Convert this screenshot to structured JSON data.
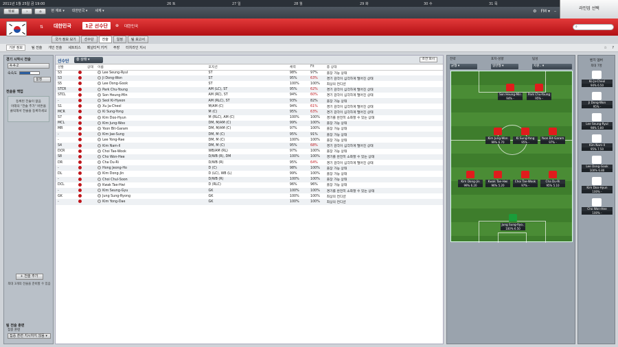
{
  "topbar": {
    "date": "2011년 1월 25일 금 19:00",
    "calendar": [
      "26 토",
      "27 일",
      "28 월",
      "29 화",
      "30 수",
      "31 목"
    ],
    "back": "뒤로",
    "nav": [
      "현 재로 ▾",
      "대한민국 ▾",
      "세계 ▾"
    ],
    "fm": "FM ▾",
    "continue": "라인업 선택"
  },
  "header": {
    "title": "대한민국",
    "squad": "1군 선수단",
    "subtitle": "대한민국",
    "search_placeholder": ""
  },
  "tabs": [
    "국가 정보 보기",
    "선수단",
    "전술",
    "일정",
    "팀 보고서"
  ],
  "subnav": [
    "기본 정보",
    "팀 전술",
    "개인 전술",
    "세트피스",
    "페널티킥 키커",
    "주장",
    "터치라인 지시"
  ],
  "left": {
    "title": "경기 시작시 전술",
    "formation": "4-4-2",
    "familiarity_label": "숙숙도",
    "familiarity": 0.55,
    "view": "설정",
    "backup_title": "전술용 백업",
    "note": "등록된 전술이 없음\n아래의 \"전술 추가\" 버튼을\n클릭해서 전술을 등록하세요",
    "add_button": "+ 전술 추가",
    "hint": "최대 3개의 전술을 준비할 수 있음",
    "match_title": "팀 전술 훈련",
    "training_label": "집중 훈련",
    "training_value": "집중 훈련 지시하지 않음 ▾"
  },
  "squad": {
    "label": "선수단",
    "view": "총 상태 ▾",
    "filter": "조건 표시",
    "columns": [
      "선발",
      "",
      "상태",
      "이름",
      "포지션",
      "체력",
      "Fit",
      "종 상태"
    ]
  },
  "players": [
    [
      "S3",
      "Lee Seung-Ryul",
      "ST",
      "98%",
      "97%",
      "출장 가능 상태",
      ""
    ],
    [
      "S3",
      "Ji Dong-Won",
      "ST",
      "95%",
      "63%",
      "경기 감각이 심각하게 떨어진 상태",
      "r"
    ],
    [
      "S5",
      "Lee Dong-Gook",
      "ST",
      "100%",
      "100%",
      "최상의 컨디션",
      ""
    ],
    [
      "STCR",
      "Park Chu-Young",
      "AM (LC), ST",
      "95%",
      "62%",
      "경기 감각이 심각하게 떨어진 상태",
      "r"
    ],
    [
      "STCL",
      "Son Heung-Min",
      "AM (RC), ST",
      "94%",
      "60%",
      "경기 감각이 심각하게 떨어진 상태",
      "r"
    ],
    [
      "-",
      "Seol Ki-Hyeon",
      "AM (RLC), ST",
      "93%",
      "82%",
      "출장 가능 상태",
      ""
    ],
    [
      "S1",
      "Xu Ja-Cheol",
      "M/AM (C)",
      "94%",
      "61%",
      "경기 감각이 심각하게 떨어진 상태",
      "r"
    ],
    [
      "MCR",
      "Ki Sung-Yong",
      "M (C)",
      "95%",
      "63%",
      "경기 감각이 심각하게 떨어진 상태",
      "r"
    ],
    [
      "S7",
      "Kim Doo-Hyun",
      "M (RLC), AM (C)",
      "100%",
      "100%",
      "경기를 완전히 소화할 수 있는 상태",
      ""
    ],
    [
      "MCL",
      "Kim Jung-Woo",
      "DM, M/AM (C)",
      "99%",
      "100%",
      "출장 가능 상태",
      ""
    ],
    [
      "MR",
      "Yoon Bit-Garam",
      "DM, M/AM (C)",
      "97%",
      "100%",
      "출장 가능 상태",
      ""
    ],
    [
      "-",
      "Kim Jae-Sung",
      "DM, M (C)",
      "95%",
      "91%",
      "출장 가능 상태",
      ""
    ],
    [
      "-",
      "Lee Yong-Rae",
      "DM, M (C)",
      "100%",
      "100%",
      "출장 가능 상태",
      ""
    ],
    [
      "S4",
      "Kim Nam-Il",
      "DM, M (C)",
      "95%",
      "68%",
      "경기 감각이 심각하게 떨어진 상태",
      "r"
    ],
    [
      "DCR",
      "Choi Tae-Wook",
      "WB/AM (RL)",
      "97%",
      "100%",
      "출장 가능 상태",
      ""
    ],
    [
      "S8",
      "Cho Won-Hee",
      "D/WB (R), DM",
      "100%",
      "100%",
      "경기를 완전히 소화할 수 있는 상태",
      ""
    ],
    [
      "DR",
      "Cha Du-Ri",
      "D/WB (R)",
      "95%",
      "64%",
      "경기 감각이 심각하게 떨어진 상태",
      "r"
    ],
    [
      "-",
      "Hong Jeong-Ho",
      "D (C)",
      "98%",
      "100%",
      "출장 가능 상태",
      ""
    ],
    [
      "DL",
      "Kim Dong-Jin",
      "D (LC), WB (L)",
      "99%",
      "100%",
      "출장 가능 상태",
      ""
    ],
    [
      "-",
      "Choi Chul-Soon",
      "D/WB (R)",
      "100%",
      "100%",
      "출장 가능 상태",
      ""
    ],
    [
      "DCL",
      "Kwak Tae-Hwi",
      "D (RLC)",
      "96%",
      "96%",
      "출장 가능 상태",
      ""
    ],
    [
      "-",
      "Kim Seung-Gyu",
      "GK",
      "100%",
      "100%",
      "경기를 완전히 소화할 수 있는 상태",
      ""
    ],
    [
      "GK",
      "Jung Sung-Ryong",
      "GK",
      "100%",
      "100%",
      "최상의 컨디션",
      ""
    ],
    [
      "-",
      "Kim Yong-Dae",
      "GK",
      "100%",
      "100%",
      "최상의 컨디션",
      ""
    ]
  ],
  "pitch": {
    "labels": [
      "전략",
      "포지-성향",
      "팀성"
    ],
    "dropdowns": [
      "균형 ▾",
      "일반형 ▾",
      "지원.. ▾"
    ],
    "players": [
      [
        "Son Heung-Min",
        "94%",
        "-"
      ],
      [
        "Park Chu-Young",
        "95%",
        "-"
      ],
      [
        "Kim Jung-Won",
        "99%",
        "6.70"
      ],
      [
        "Ki Sung-Yong",
        "95%",
        "-"
      ],
      [
        "Yoon Bit-Garam",
        "97%",
        "-"
      ],
      [
        "Kim Dong-Jin",
        "99%",
        "6.20"
      ],
      [
        "Kwak Tae-Hwi",
        "96%",
        "5.20"
      ],
      [
        "Choi Tae-Wook",
        "97%",
        "-"
      ],
      [
        "Cha Du-Ri",
        "95%",
        "5.10"
      ],
      [
        "Jung Sung-Ryo..",
        "100%",
        "6.50"
      ]
    ]
  },
  "bench": {
    "title": "벤치 멤버",
    "subtitle": "최대 7명",
    "players": [
      [
        "Ko Ja-Cheol",
        "94%",
        "6.50"
      ],
      [
        "Ji Dong-Won",
        "95%",
        "-"
      ],
      [
        "Lee Seung-Ryul",
        "98%",
        "5.80"
      ],
      [
        "Kim Nam-Il",
        "95%",
        "7.50"
      ],
      [
        "Lee Dong-Gook",
        "100%",
        "6.80"
      ],
      [
        "Kim Doo-Hyun",
        "100%",
        "-"
      ],
      [
        "Cho Won-Hee",
        "100%",
        "-"
      ]
    ]
  }
}
